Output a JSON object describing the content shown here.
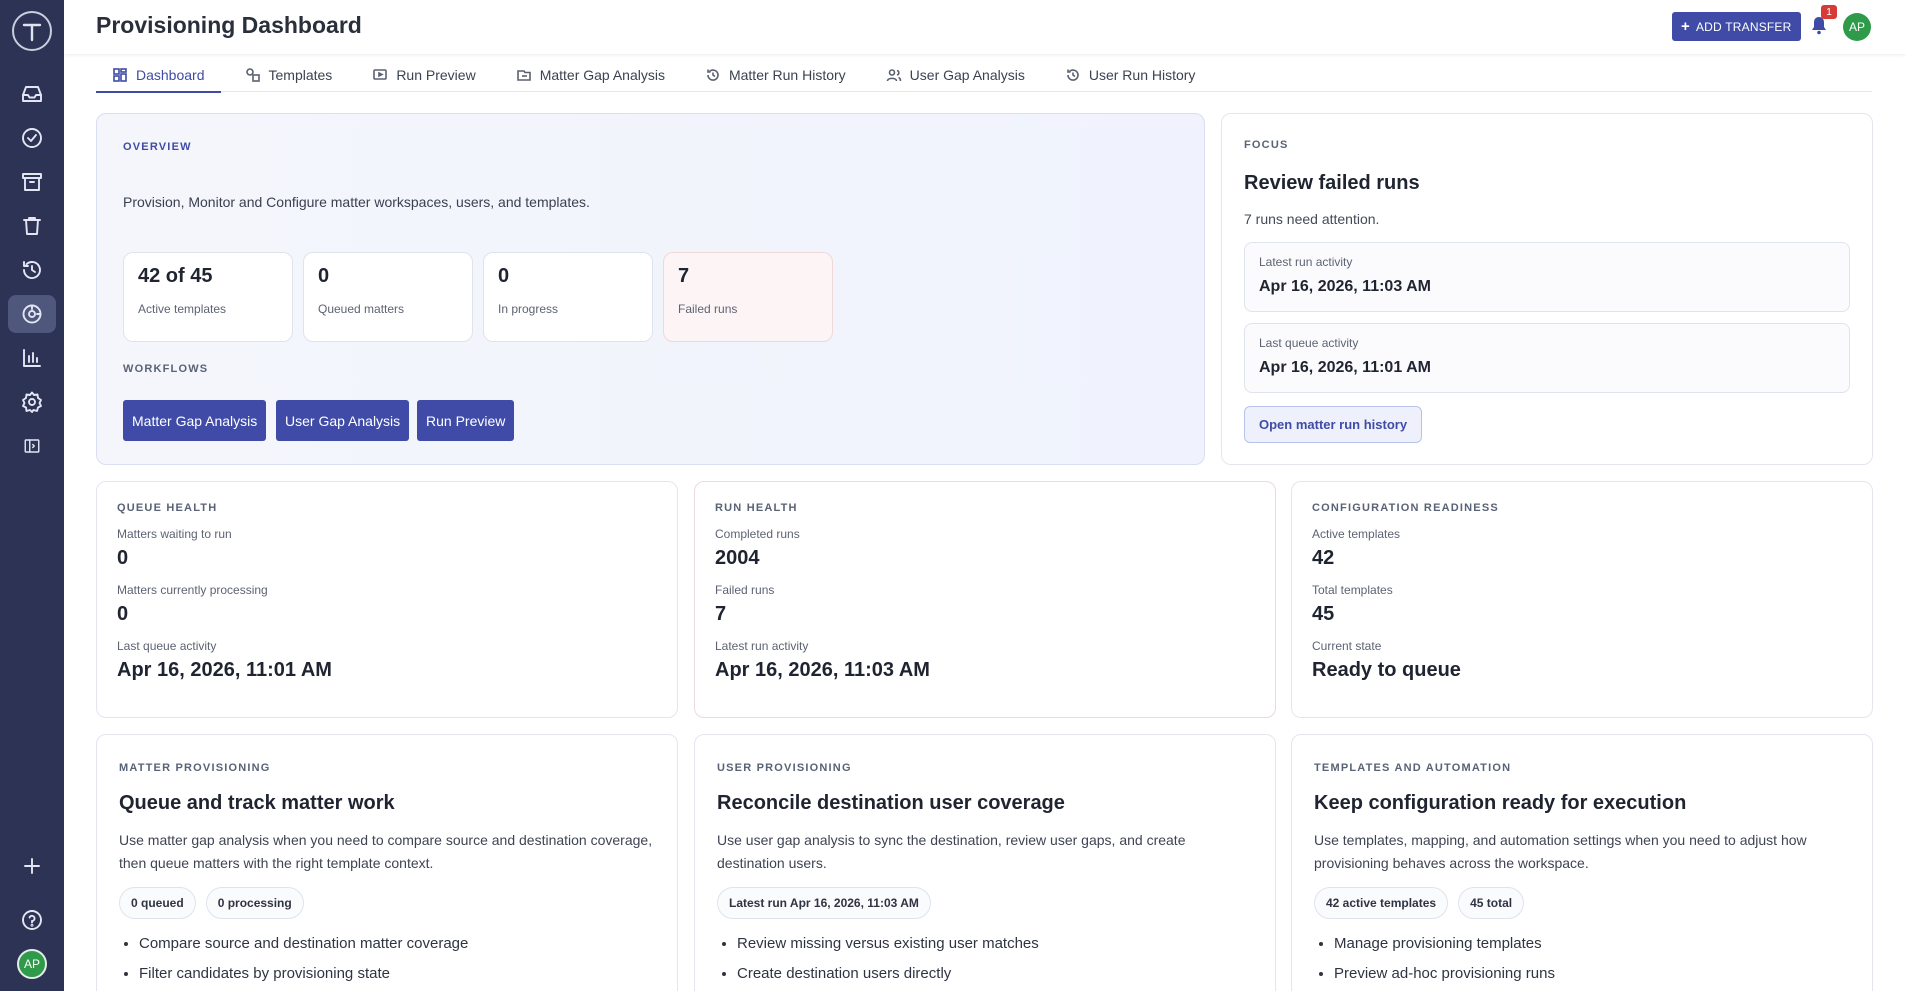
{
  "header": {
    "title": "Provisioning Dashboard",
    "add_transfer": "ADD TRANSFER",
    "notification_count": "1",
    "user_initials": "AP"
  },
  "sidebar": {
    "items": [
      "inbox-icon",
      "check-circle-icon",
      "archive-icon",
      "trash-icon",
      "history-icon",
      "provisioning-icon",
      "chart-icon",
      "settings-icon",
      "panel-toggle-icon"
    ],
    "bottom": [
      "plus-icon",
      "help-icon"
    ],
    "user_initials": "AP"
  },
  "tabs": [
    {
      "label": "Dashboard",
      "icon": "grid-icon",
      "active": true
    },
    {
      "label": "Templates",
      "icon": "template-icon"
    },
    {
      "label": "Run Preview",
      "icon": "preview-icon"
    },
    {
      "label": "Matter Gap Analysis",
      "icon": "gap-icon"
    },
    {
      "label": "Matter Run History",
      "icon": "history-icon"
    },
    {
      "label": "User Gap Analysis",
      "icon": "users-icon"
    },
    {
      "label": "User Run History",
      "icon": "history-icon"
    }
  ],
  "overview": {
    "eyebrow": "OVERVIEW",
    "description": "Provision, Monitor and Configure matter workspaces, users, and templates.",
    "stats": [
      {
        "value": "42 of 45",
        "label": "Active templates"
      },
      {
        "value": "0",
        "label": "Queued matters"
      },
      {
        "value": "0",
        "label": "In progress"
      },
      {
        "value": "7",
        "label": "Failed runs"
      }
    ],
    "workflows_label": "WORKFLOWS",
    "workflows": [
      "Matter Gap Analysis",
      "User Gap Analysis",
      "Run Preview"
    ]
  },
  "focus": {
    "eyebrow": "FOCUS",
    "title": "Review failed runs",
    "subtitle": "7 runs need attention.",
    "latest_run_label": "Latest run activity",
    "latest_run_value": "Apr 16, 2026, 11:03 AM",
    "last_queue_label": "Last queue activity",
    "last_queue_value": "Apr 16, 2026, 11:01 AM",
    "button": "Open matter run history"
  },
  "queue_health": {
    "eyebrow": "QUEUE HEALTH",
    "l1": "Matters waiting to run",
    "v1": "0",
    "l2": "Matters currently processing",
    "v2": "0",
    "l3": "Last queue activity",
    "v3": "Apr 16, 2026, 11:01 AM"
  },
  "run_health": {
    "eyebrow": "RUN HEALTH",
    "l1": "Completed runs",
    "v1": "2004",
    "l2": "Failed runs",
    "v2": "7",
    "l3": "Latest run activity",
    "v3": "Apr 16, 2026, 11:03 AM"
  },
  "config_readiness": {
    "eyebrow": "CONFIGURATION READINESS",
    "l1": "Active templates",
    "v1": "42",
    "l2": "Total templates",
    "v2": "45",
    "l3": "Current state",
    "v3": "Ready to queue"
  },
  "matter_provisioning": {
    "eyebrow": "MATTER PROVISIONING",
    "title": "Queue and track matter work",
    "description": "Use matter gap analysis when you need to compare source and destination coverage, then queue matters with the right template context.",
    "pills": [
      "0 queued",
      "0 processing"
    ],
    "bullets": [
      "Compare source and destination matter coverage",
      "Filter candidates by provisioning state"
    ]
  },
  "user_provisioning": {
    "eyebrow": "USER PROVISIONING",
    "title": "Reconcile destination user coverage",
    "description": "Use user gap analysis to sync the destination, review user gaps, and create destination users.",
    "pills": [
      "Latest run Apr 16, 2026, 11:03 AM"
    ],
    "bullets": [
      "Review missing versus existing user matches",
      "Create destination users directly"
    ]
  },
  "templates_automation": {
    "eyebrow": "TEMPLATES AND AUTOMATION",
    "title": "Keep configuration ready for execution",
    "description": "Use templates, mapping, and automation settings when you need to adjust how provisioning behaves across the workspace.",
    "pills": [
      "42 active templates",
      "45 total"
    ],
    "bullets": [
      "Manage provisioning templates",
      "Preview ad-hoc provisioning runs"
    ]
  }
}
